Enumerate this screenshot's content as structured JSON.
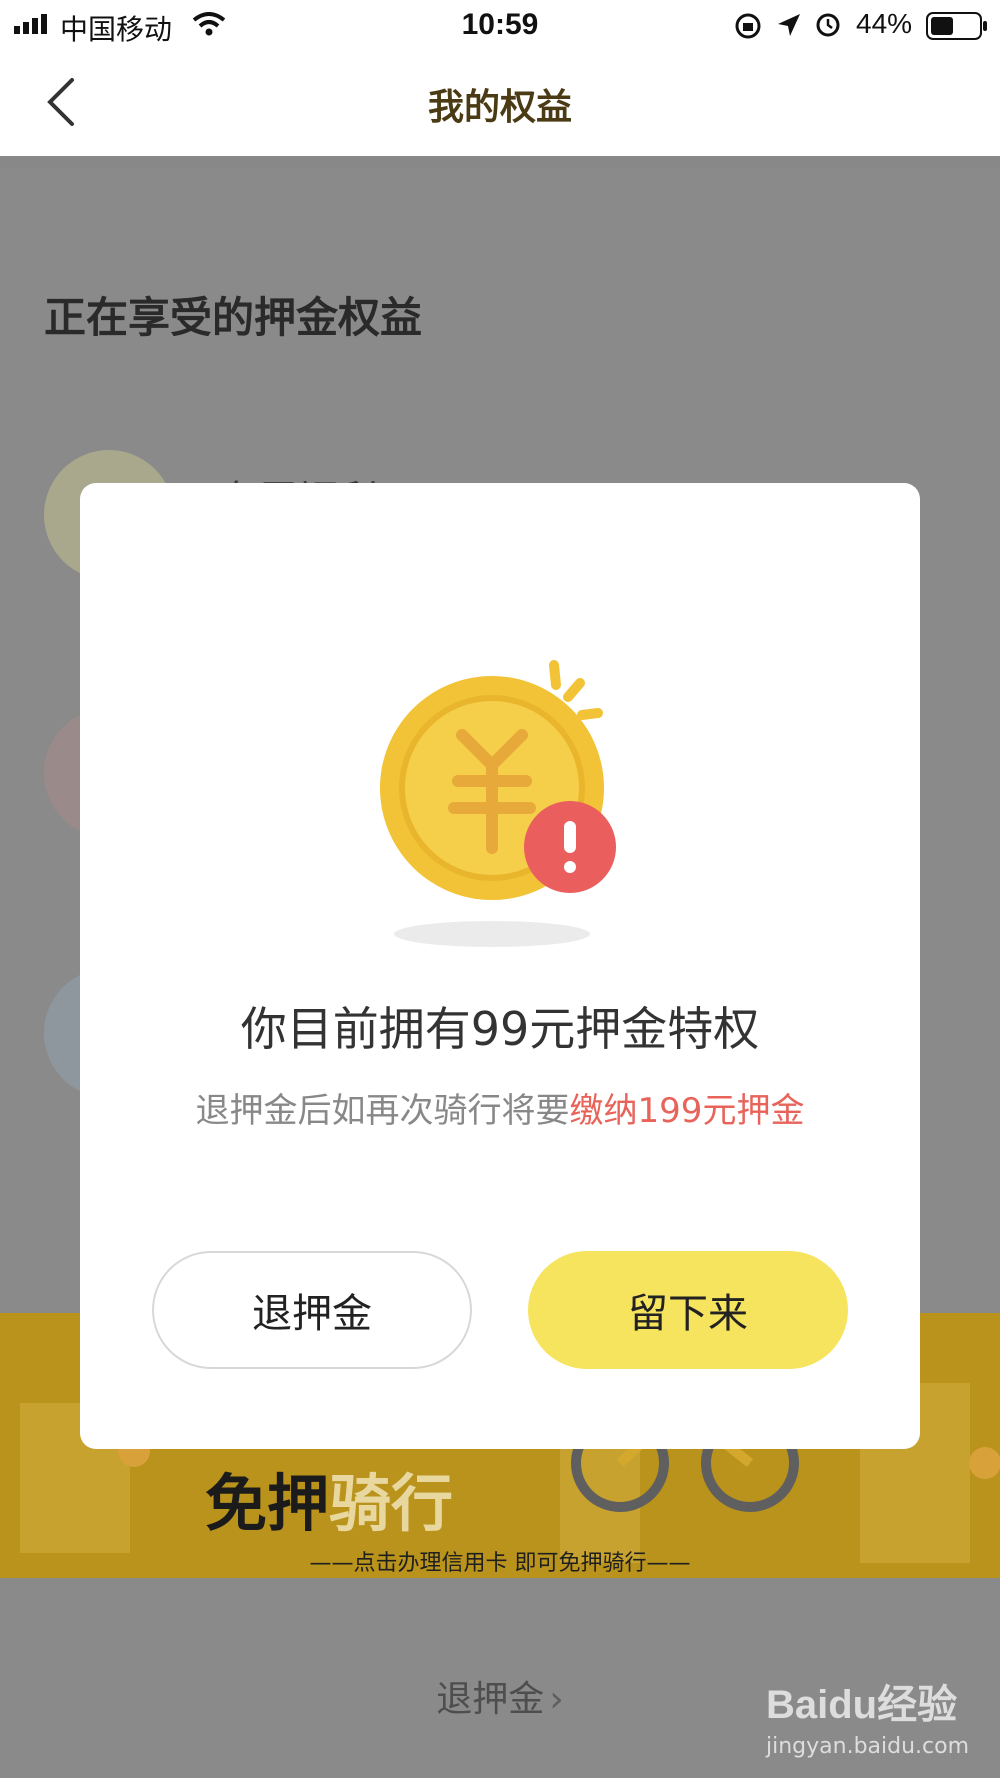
{
  "status_bar": {
    "carrier": "中国移动",
    "time": "10:59",
    "battery": "44%"
  },
  "nav": {
    "title": "我的权益",
    "back_icon": "chevron-left-icon"
  },
  "page": {
    "section_title": "正在享受的押金权益",
    "benefit_label": "专属福利",
    "banner": {
      "title_part1": "免押",
      "title_part2": "骑行",
      "subtitle": "——点击办理信用卡 即可免押骑行——"
    },
    "bottom_link": "退押金",
    "watermark": {
      "line1": "Baidu经验",
      "line2": "jingyan.baidu.com"
    }
  },
  "modal": {
    "icon": "coin-warning-icon",
    "title": "你目前拥有99元押金特权",
    "desc_prefix": "退押金后如再次骑行将要",
    "desc_highlight": "缴纳199元押金",
    "refund_button": "退押金",
    "stay_button": "留下来"
  },
  "colors": {
    "brand_gold": "#b99420",
    "stay_button": "#f6e45f",
    "highlight_red": "#e8635a",
    "coin_yellow": "#f4c53a",
    "alert_red": "#ea5e5e"
  }
}
